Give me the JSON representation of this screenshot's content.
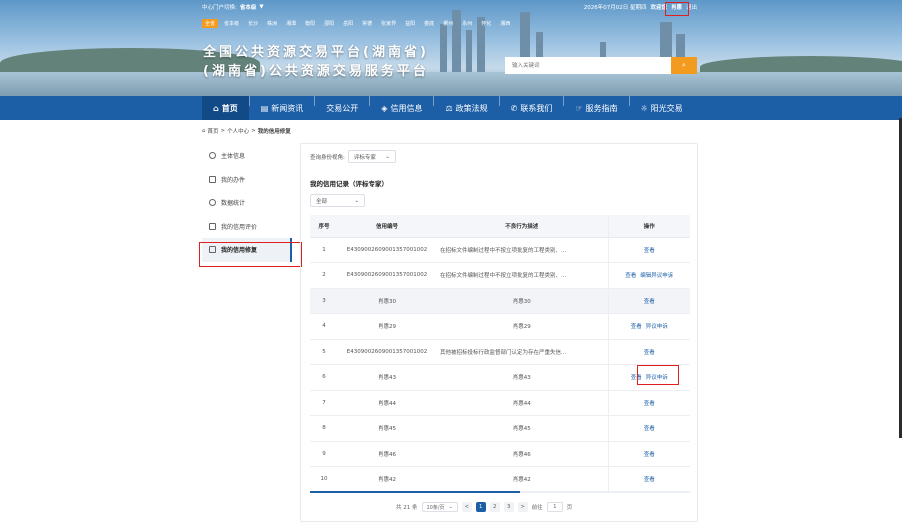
{
  "topbar": {
    "site_label": "中心门户切换:",
    "site_value": "省本级",
    "date": "2026年07月02日 星期四",
    "welcome": "欢迎您",
    "user": "肖惠",
    "logout": "退出"
  },
  "cities": [
    "全省",
    "省本级",
    "长沙",
    "株洲",
    "湘潭",
    "衡阳",
    "邵阳",
    "岳阳",
    "常德",
    "张家界",
    "益阳",
    "娄底",
    "郴州",
    "永州",
    "怀化",
    "湘西"
  ],
  "header": {
    "title_line1": "全国公共资源交易平台(湖南省)",
    "title_line2": "(湖南省)公共资源交易服务平台"
  },
  "search": {
    "placeholder": "输入关键词",
    "button_icon": "search-icon"
  },
  "nav": {
    "items": [
      {
        "label": "首页",
        "icon": "home-icon"
      },
      {
        "label": "新闻资讯",
        "icon": "news-icon"
      },
      {
        "label": "交易公开",
        "icon": ""
      },
      {
        "label": "信用信息",
        "icon": "credit-icon"
      },
      {
        "label": "政策法规",
        "icon": "policy-icon"
      },
      {
        "label": "联系我们",
        "icon": "contact-icon"
      },
      {
        "label": "服务指南",
        "icon": "guide-icon"
      },
      {
        "label": "阳光交易",
        "icon": "sun-icon"
      }
    ]
  },
  "breadcrumb": {
    "home": "首页",
    "sep": ">",
    "level1": "个人中心",
    "current": "我的信用修复"
  },
  "sidebar": {
    "items": [
      {
        "label": "主体信息",
        "icon": "user-icon"
      },
      {
        "label": "我的办件",
        "icon": "file-icon"
      },
      {
        "label": "数据统计",
        "icon": "clock-icon"
      },
      {
        "label": "我的信用评价",
        "icon": "rating-icon"
      },
      {
        "label": "我的信用修复",
        "icon": "repair-icon"
      }
    ],
    "active_index": 4
  },
  "filter": {
    "label": "查询身份视角:",
    "value": "评标专家"
  },
  "section": {
    "title": "我的信用记录（评标专家）",
    "status_value": "全部"
  },
  "table": {
    "headers": [
      "序号",
      "信用编号",
      "不良行为描述",
      "操作"
    ],
    "rows": [
      {
        "no": "1",
        "code": "E430900260900135700100​2",
        "desc": "在招标文件编制过程中不按立项批复的工程类别、...",
        "ops": [
          "查看"
        ]
      },
      {
        "no": "2",
        "code": "E4309002609001357001002",
        "desc": "在招标文件编制过程中不按立项批复的工程类别、...",
        "ops": [
          "查看",
          "编辑异议申诉"
        ]
      },
      {
        "no": "3",
        "code": "肖惠30",
        "desc": "肖惠30",
        "ops": [
          "查看"
        ]
      },
      {
        "no": "4",
        "code": "肖惠29",
        "desc": "肖惠29",
        "ops": [
          "查看",
          "异议申诉"
        ]
      },
      {
        "no": "5",
        "code": "E4309002609001357001002",
        "desc": "其他被招标投标行政监督部门认定为存在严重失信...",
        "ops": [
          "查看"
        ]
      },
      {
        "no": "6",
        "code": "肖惠43",
        "desc": "肖惠43",
        "ops": [
          "查看",
          "异议申诉"
        ]
      },
      {
        "no": "7",
        "code": "肖惠44",
        "desc": "肖惠44",
        "ops": [
          "查看"
        ]
      },
      {
        "no": "8",
        "code": "肖惠45",
        "desc": "肖惠45",
        "ops": [
          "查看"
        ]
      },
      {
        "no": "9",
        "code": "肖惠46",
        "desc": "肖惠46",
        "ops": [
          "查看"
        ]
      },
      {
        "no": "10",
        "code": "肖惠42",
        "desc": "肖惠42",
        "ops": [
          "查看"
        ]
      }
    ]
  },
  "pager": {
    "total": "共 21 条",
    "page_size": "10条/页",
    "pages": [
      "1",
      "2",
      "3"
    ],
    "current": "1",
    "prev": "<",
    "next": ">",
    "goto_label": "前往",
    "goto_value": "1",
    "page_unit": "页"
  }
}
